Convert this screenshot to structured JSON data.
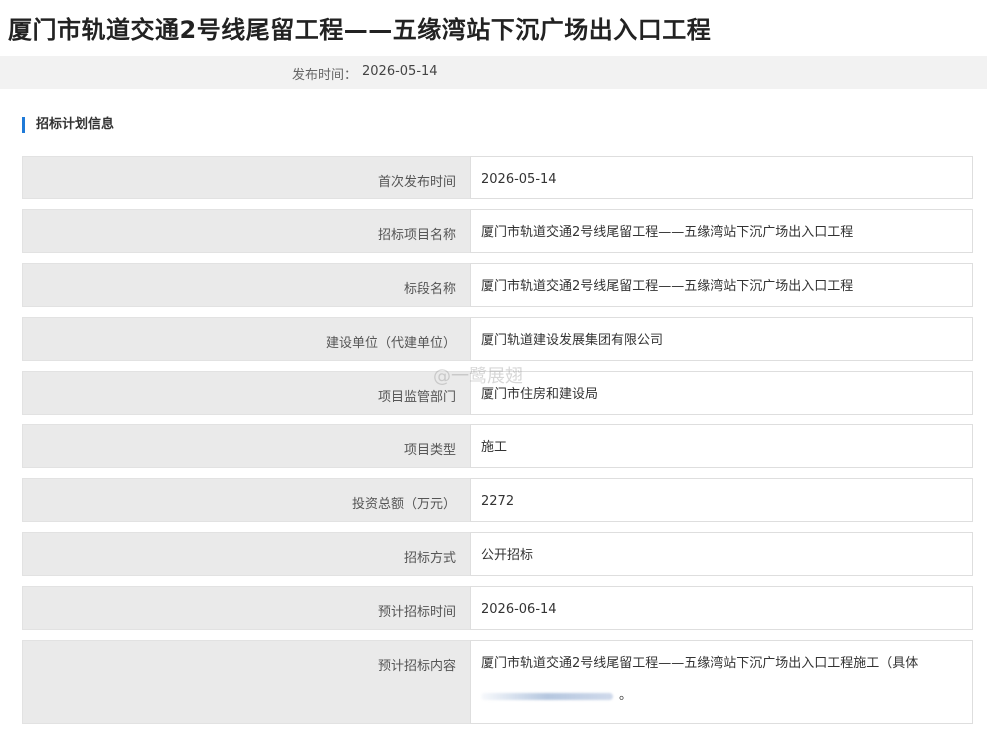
{
  "page": {
    "title": "厦门市轨道交通2号线尾留工程——五缘湾站下沉广场出入口工程",
    "publish_label": "发布时间：",
    "publish_date": "2026-05-14"
  },
  "section": {
    "title": "招标计划信息"
  },
  "rows": [
    {
      "label": "首次发布时间",
      "value": "2026-05-14"
    },
    {
      "label": "招标项目名称",
      "value": "厦门市轨道交通2号线尾留工程——五缘湾站下沉广场出入口工程"
    },
    {
      "label": "标段名称",
      "value": "厦门市轨道交通2号线尾留工程——五缘湾站下沉广场出入口工程"
    },
    {
      "label": "建设单位（代建单位）",
      "value": "厦门轨道建设发展集团有限公司"
    },
    {
      "label": "项目监管部门",
      "value": "厦门市住房和建设局"
    },
    {
      "label": "项目类型",
      "value": "施工"
    },
    {
      "label": "投资总额（万元）",
      "value": "2272"
    },
    {
      "label": "招标方式",
      "value": "公开招标"
    },
    {
      "label": "预计招标时间",
      "value": "2026-06-14"
    },
    {
      "label": "预计招标内容",
      "value": "厦门市轨道交通2号线尾留工程——五缘湾站下沉广场出入口工程施工（具体",
      "value_end": "。"
    }
  ],
  "watermark": {
    "text": "@一鹭展翅"
  },
  "colors": {
    "accent": "#1f7ad8",
    "label_bg": "#eaeaea",
    "pub_bar_bg": "#f2f2f2"
  }
}
